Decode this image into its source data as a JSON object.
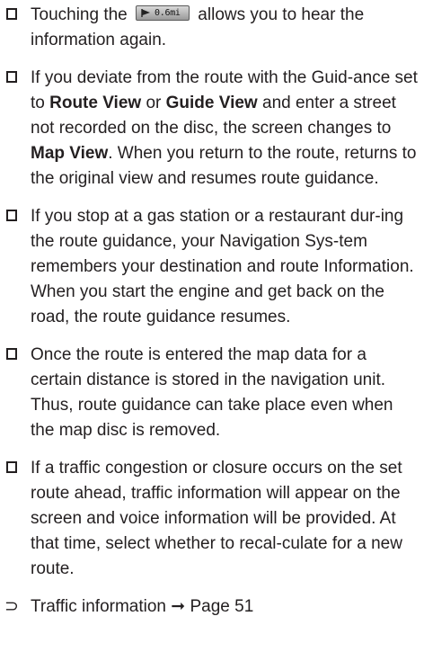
{
  "items": [
    {
      "before": "Touching the",
      "chip_text": "0.6mi",
      "after": "allows you to hear the information again."
    },
    {
      "p1": "If you deviate from the route with the Guid-ance set to ",
      "b1": "Route View",
      "p2": " or ",
      "b2": "Guide View",
      "p3": " and enter a street not recorded on the disc, the screen changes to ",
      "b3": "Map View",
      "p4": ". When you return to the route, returns to the original view and resumes route guidance."
    },
    {
      "text": "If you stop at a gas station or a restaurant dur-ing the route guidance, your Navigation Sys-tem remembers your destination and route Information. When you start the engine and get back on the road, the route guidance resumes."
    },
    {
      "text": "Once the route is entered the map data for a certain distance is stored in the navigation unit. Thus, route guidance can take place even when the map disc is removed."
    },
    {
      "text": "If a traffic congestion or closure occurs on the set route ahead, traffic information will appear on the screen and voice information will be provided. At that time, select whether to recal-culate for a new route."
    }
  ],
  "reference": {
    "icon": "⊃",
    "text": "Traffic information ➞ Page 51"
  },
  "icons": {
    "bullet": "checkbox-icon",
    "reference": "arrow-bullet-icon",
    "chip": "flag-icon"
  },
  "colors": {
    "text": "#231f20",
    "chip_bg": "#b8b8b8"
  }
}
